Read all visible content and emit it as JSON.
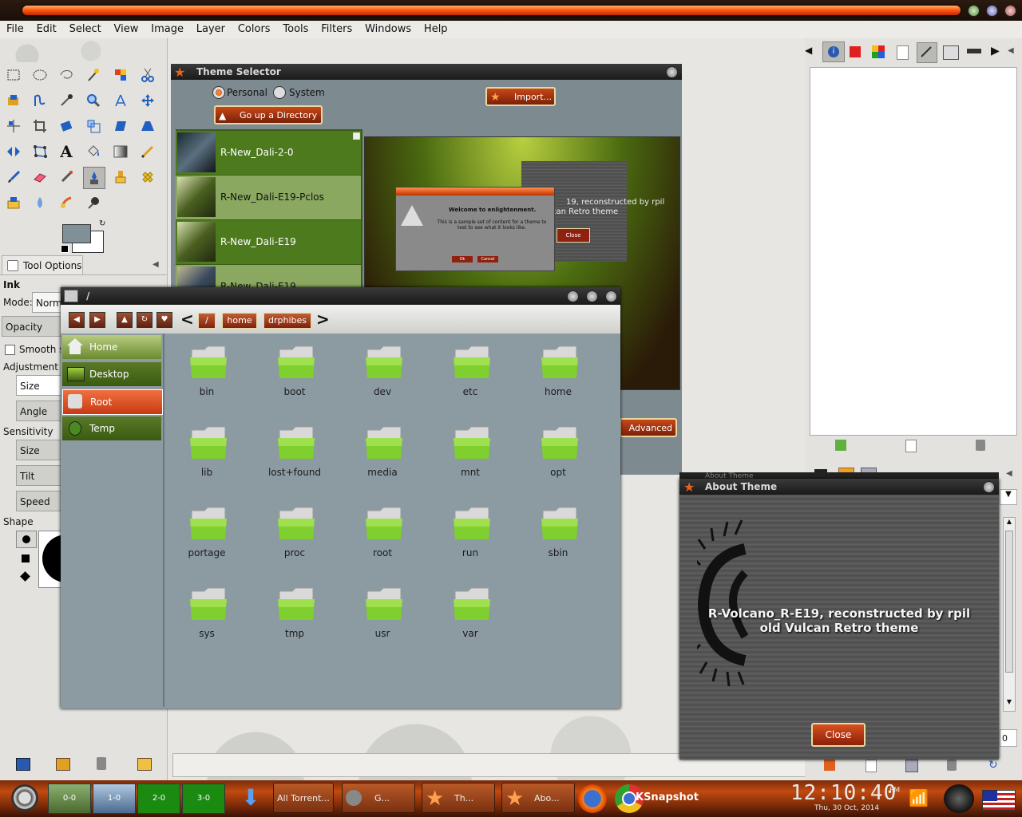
{
  "menubar": {
    "items": [
      "File",
      "Edit",
      "Select",
      "View",
      "Image",
      "Layer",
      "Colors",
      "Tools",
      "Filters",
      "Windows",
      "Help"
    ]
  },
  "toolbox": {
    "tool_options_tab": "Tool Options",
    "tool_name": "Ink",
    "mode_label": "Mode:",
    "mode_value": "Norm",
    "opacity_label": "Opacity",
    "smooth_label": "Smooth s",
    "adjustment_label": "Adjustment",
    "adj_size": "Size",
    "adj_angle": "Angle",
    "sensitivity_label": "Sensitivity",
    "sens_size": "Size",
    "sens_tilt": "Tilt",
    "sens_speed": "Speed",
    "shape_label": "Shape"
  },
  "theme_selector": {
    "title": "Theme Selector",
    "radio_personal": "Personal",
    "radio_system": "System",
    "go_up_button": "Go up a Directory",
    "import_button": "Import...",
    "advanced_button": "Advanced",
    "themes": [
      "R-New_Dali-2-0",
      "R-New_Dali-E19-Pclos",
      "R-New_Dali-E19",
      "R-New_Dali-E19"
    ],
    "preview": {
      "dialog_title": "Welcome to enlightenment.",
      "dialog_text": "This is a sample set of content for a theme to test to see what it looks like.",
      "ok": "Ok",
      "cancel": "Cancel",
      "close": "Close",
      "bg_text_1": "19, reconstructed by rpil",
      "bg_text_2": "can Retro theme"
    }
  },
  "file_manager": {
    "title": "/",
    "breadcrumb": [
      "/",
      "home",
      "drphibes"
    ],
    "sidebar": [
      {
        "label": "Home"
      },
      {
        "label": "Desktop"
      },
      {
        "label": "Root"
      },
      {
        "label": "Temp"
      }
    ],
    "folders": [
      "bin",
      "boot",
      "dev",
      "etc",
      "home",
      "lib",
      "lost+found",
      "media",
      "mnt",
      "opt",
      "portage",
      "proc",
      "root",
      "run",
      "sbin",
      "sys",
      "tmp",
      "usr",
      "var"
    ]
  },
  "about_theme": {
    "title_behind": "About Theme",
    "title": "About Theme",
    "line1": "R-Volcano_R-E19, reconstructed by rpil",
    "line2": "old Vulcan Retro theme",
    "close_button": "Close"
  },
  "taskbar": {
    "pager": [
      "0-0",
      "1-0",
      "2-0",
      "3-0"
    ],
    "tasks": [
      {
        "label": "All Torrent..."
      },
      {
        "label": "G..."
      },
      {
        "label": "Th..."
      },
      {
        "label": "Abo..."
      }
    ],
    "ksnapshot": "KSnapshot",
    "clock": "12:10:40",
    "clock_ampm": "PM",
    "date": "Thu, 30 Oct, 2014"
  },
  "right_dock": {
    "spin_value": "0"
  },
  "colors": {
    "accent_orange": "#e8621a",
    "folder_green": "#8fd13a",
    "theme_list_green": "#4e7a1e",
    "selected_red": "#c83a12"
  }
}
